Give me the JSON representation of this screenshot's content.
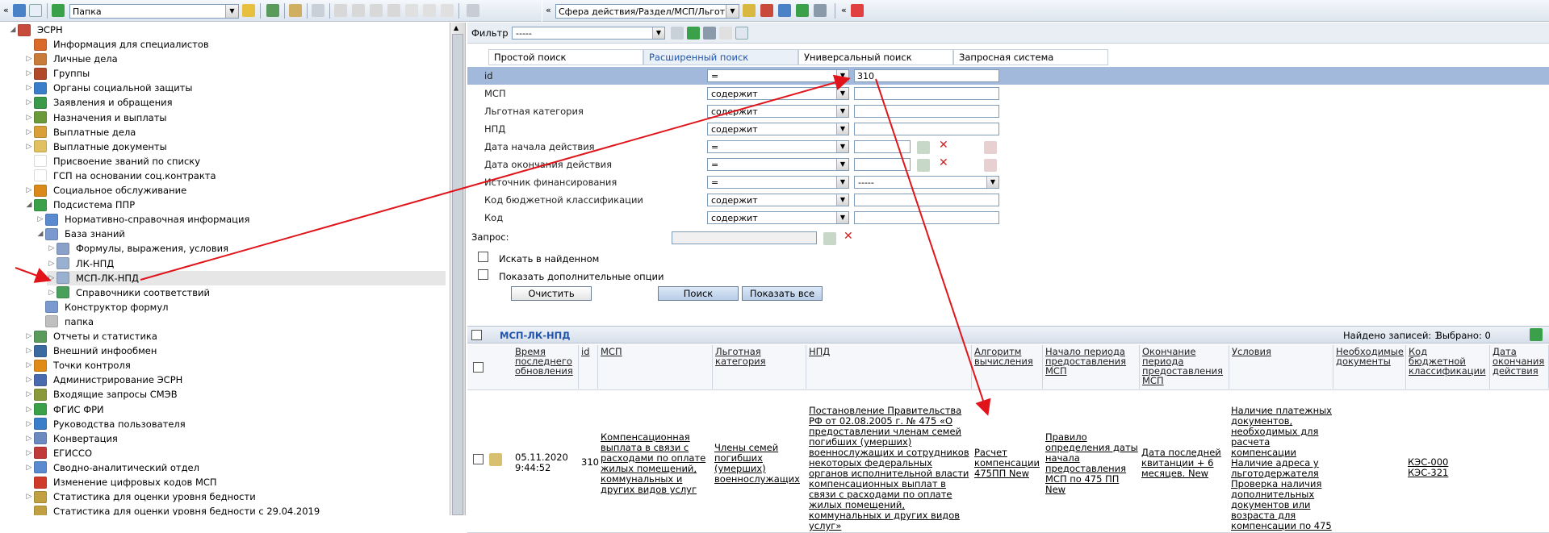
{
  "toolbar": {
    "folder_select": "Папка",
    "scope_select": "Сфера действия/Раздел/МСП/Льгот",
    "collapse_left": "«",
    "collapse_mid": "«",
    "collapse_right": "«"
  },
  "tree": {
    "root": "ЭСРН",
    "items": [
      {
        "label": "Информация для специалистов",
        "color": "#d96a2a"
      },
      {
        "label": "Личные дела",
        "color": "#c97b3a"
      },
      {
        "label": "Группы",
        "color": "#b04a2a"
      },
      {
        "label": "Органы социальной защиты",
        "color": "#3a7ec9"
      },
      {
        "label": "Заявления и обращения",
        "color": "#3a9a4a"
      },
      {
        "label": "Назначения и выплаты",
        "color": "#6a9a3a"
      },
      {
        "label": "Выплатные дела",
        "color": "#d9a03a"
      },
      {
        "label": "Выплатные документы",
        "color": "#e0c060"
      },
      {
        "label": "Присвоение званий по списку",
        "color": "#ffffff"
      },
      {
        "label": "ГСП на основании соц.контракта",
        "color": "#ffffff"
      },
      {
        "label": "Социальное обслуживание",
        "color": "#d98a1a"
      },
      {
        "label": "Подсистема ППР",
        "color": "#3aa04a"
      },
      {
        "label": "Нормативно-справочная информация",
        "color": "#5a8ad0"
      },
      {
        "label": "База знаний",
        "color": "#7a9acf"
      },
      {
        "label": "Формулы, выражения, условия",
        "color": "#8aa0c8"
      },
      {
        "label": "ЛК-НПД",
        "color": "#9ab0d0"
      },
      {
        "label": "МСП-ЛК-НПД",
        "color": "#9ab0d0"
      },
      {
        "label": "Справочники соответствий",
        "color": "#4aa05a"
      },
      {
        "label": "Конструктор формул",
        "color": "#7a9acf"
      },
      {
        "label": "папка",
        "color": "#c0c0c0"
      },
      {
        "label": "Отчеты и статистика",
        "color": "#5a9a5a"
      },
      {
        "label": "Внешний инфообмен",
        "color": "#3a6aa0"
      },
      {
        "label": "Точки контроля",
        "color": "#e08a1a"
      },
      {
        "label": "Администрирование ЭСРН",
        "color": "#4a6ab0"
      },
      {
        "label": "Входящие запросы СМЭВ",
        "color": "#8a9a3a"
      },
      {
        "label": "ФГИС ФРИ",
        "color": "#3aa04a"
      },
      {
        "label": "Руководства пользователя",
        "color": "#3a7ec9"
      },
      {
        "label": "Конвертация",
        "color": "#6a8ac0"
      },
      {
        "label": "ЕГИССО",
        "color": "#c03a3a"
      },
      {
        "label": "Сводно-аналитический отдел",
        "color": "#5a8ad0"
      },
      {
        "label": "Изменение цифровых кодов МСП",
        "color": "#d03a2a"
      },
      {
        "label": "Статистика для оценки уровня бедности",
        "color": "#c0a040"
      },
      {
        "label": "Статистика для оценки уровня бедности с 29.04.2019",
        "color": "#c0a040"
      }
    ]
  },
  "filter": {
    "label": "Фильтр",
    "value": "-----",
    "tabs": [
      "Простой поиск",
      "Расширенный поиск",
      "Универсальный поиск",
      "Запросная система"
    ],
    "rows": [
      {
        "label": "id",
        "op": "=",
        "value": "310"
      },
      {
        "label": "МСП",
        "op": "содержит",
        "value": ""
      },
      {
        "label": "Льготная категория",
        "op": "содержит",
        "value": ""
      },
      {
        "label": "НПД",
        "op": "содержит",
        "value": ""
      },
      {
        "label": "Дата начала действия",
        "op": "=",
        "value": ""
      },
      {
        "label": "Дата окончания действия",
        "op": "=",
        "value": ""
      },
      {
        "label": "Источник финансирования",
        "op": "=",
        "value": "-----"
      },
      {
        "label": "Код бюджетной классификации",
        "op": "содержит",
        "value": ""
      },
      {
        "label": "Код",
        "op": "содержит",
        "value": ""
      }
    ],
    "query_label": "Запрос:",
    "search_in_found": "Искать в найденном",
    "show_options": "Показать дополнительные опции",
    "clear_btn": "Очистить",
    "search_btn": "Поиск",
    "show_all_btn": "Показать все"
  },
  "grid": {
    "title": "МСП-ЛК-НПД",
    "found": "Найдено записей: 1",
    "selected": "Выбрано: 0",
    "columns": [
      "Время последнего обновления",
      "id",
      "МСП",
      "Льготная категория",
      "НПД",
      "Алгоритм вычисления",
      "Начало периода предоставления МСП",
      "Окончание периода предоставления МСП",
      "Условия",
      "Необходимые документы",
      "Код бюджетной классификации",
      "Дата окончания действия"
    ],
    "row": {
      "time": "05.11.2020 9:44:52",
      "id": "310",
      "msp": "Компенсационная выплата в связи с расходами по оплате жилых помещений, коммунальных и других видов услуг",
      "category": "Члены семей погибших (умерших) военнослужащих",
      "npd": "Постановление Правительства РФ от 02.08.2005 г. № 475 «О предоставлении членам семей погибших (умерших) военнослужащих и сотрудников некоторых федеральных органов исполнительной власти компенсационных выплат в связи с расходами по оплате жилых помещений, коммунальных и других видов услуг»",
      "algo": "Расчет компенсации 475ПП New",
      "start": "Правило определения даты начала предоставления МСП по 475 ПП New",
      "end": "Дата последней квитанции + 6 месяцев. New",
      "conditions": "Наличие платежных документов, необходимых для расчета компенсации Наличие адреса у льготодержателя Проверка наличия дополнительных документов или возраста для компенсации по 475",
      "docs": "",
      "kbk1": "КЭС-000",
      "kbk2": "КЭС-321"
    }
  },
  "colors": {
    "arrow": "#e0141a",
    "highlight": "#a3b9dc",
    "accent": "#2255aa"
  }
}
